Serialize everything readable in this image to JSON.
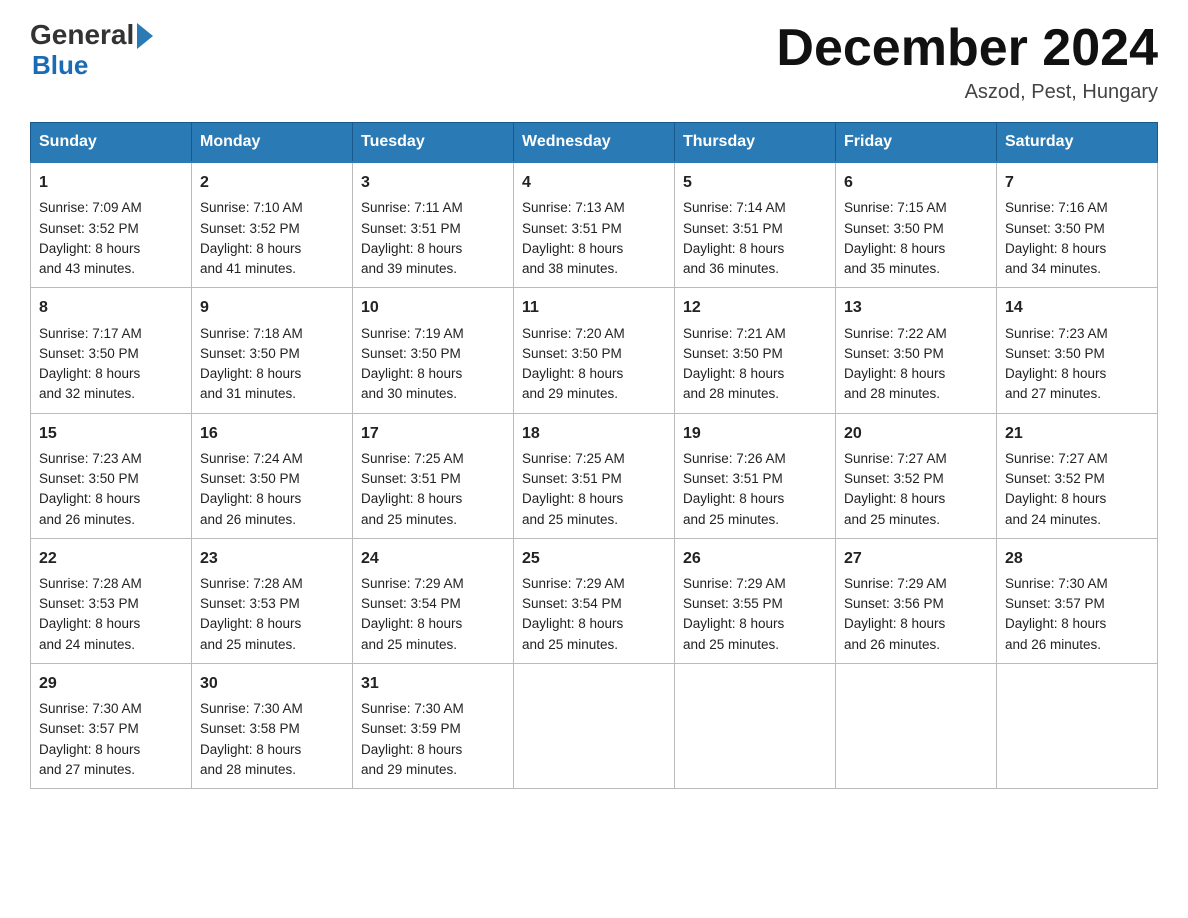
{
  "header": {
    "logo_line1": "General",
    "logo_line2": "Blue",
    "title": "December 2024",
    "location": "Aszod, Pest, Hungary"
  },
  "days_of_week": [
    "Sunday",
    "Monday",
    "Tuesday",
    "Wednesday",
    "Thursday",
    "Friday",
    "Saturday"
  ],
  "weeks": [
    [
      {
        "day": "1",
        "sunrise": "7:09 AM",
        "sunset": "3:52 PM",
        "daylight": "8 hours and 43 minutes."
      },
      {
        "day": "2",
        "sunrise": "7:10 AM",
        "sunset": "3:52 PM",
        "daylight": "8 hours and 41 minutes."
      },
      {
        "day": "3",
        "sunrise": "7:11 AM",
        "sunset": "3:51 PM",
        "daylight": "8 hours and 39 minutes."
      },
      {
        "day": "4",
        "sunrise": "7:13 AM",
        "sunset": "3:51 PM",
        "daylight": "8 hours and 38 minutes."
      },
      {
        "day": "5",
        "sunrise": "7:14 AM",
        "sunset": "3:51 PM",
        "daylight": "8 hours and 36 minutes."
      },
      {
        "day": "6",
        "sunrise": "7:15 AM",
        "sunset": "3:50 PM",
        "daylight": "8 hours and 35 minutes."
      },
      {
        "day": "7",
        "sunrise": "7:16 AM",
        "sunset": "3:50 PM",
        "daylight": "8 hours and 34 minutes."
      }
    ],
    [
      {
        "day": "8",
        "sunrise": "7:17 AM",
        "sunset": "3:50 PM",
        "daylight": "8 hours and 32 minutes."
      },
      {
        "day": "9",
        "sunrise": "7:18 AM",
        "sunset": "3:50 PM",
        "daylight": "8 hours and 31 minutes."
      },
      {
        "day": "10",
        "sunrise": "7:19 AM",
        "sunset": "3:50 PM",
        "daylight": "8 hours and 30 minutes."
      },
      {
        "day": "11",
        "sunrise": "7:20 AM",
        "sunset": "3:50 PM",
        "daylight": "8 hours and 29 minutes."
      },
      {
        "day": "12",
        "sunrise": "7:21 AM",
        "sunset": "3:50 PM",
        "daylight": "8 hours and 28 minutes."
      },
      {
        "day": "13",
        "sunrise": "7:22 AM",
        "sunset": "3:50 PM",
        "daylight": "8 hours and 28 minutes."
      },
      {
        "day": "14",
        "sunrise": "7:23 AM",
        "sunset": "3:50 PM",
        "daylight": "8 hours and 27 minutes."
      }
    ],
    [
      {
        "day": "15",
        "sunrise": "7:23 AM",
        "sunset": "3:50 PM",
        "daylight": "8 hours and 26 minutes."
      },
      {
        "day": "16",
        "sunrise": "7:24 AM",
        "sunset": "3:50 PM",
        "daylight": "8 hours and 26 minutes."
      },
      {
        "day": "17",
        "sunrise": "7:25 AM",
        "sunset": "3:51 PM",
        "daylight": "8 hours and 25 minutes."
      },
      {
        "day": "18",
        "sunrise": "7:25 AM",
        "sunset": "3:51 PM",
        "daylight": "8 hours and 25 minutes."
      },
      {
        "day": "19",
        "sunrise": "7:26 AM",
        "sunset": "3:51 PM",
        "daylight": "8 hours and 25 minutes."
      },
      {
        "day": "20",
        "sunrise": "7:27 AM",
        "sunset": "3:52 PM",
        "daylight": "8 hours and 25 minutes."
      },
      {
        "day": "21",
        "sunrise": "7:27 AM",
        "sunset": "3:52 PM",
        "daylight": "8 hours and 24 minutes."
      }
    ],
    [
      {
        "day": "22",
        "sunrise": "7:28 AM",
        "sunset": "3:53 PM",
        "daylight": "8 hours and 24 minutes."
      },
      {
        "day": "23",
        "sunrise": "7:28 AM",
        "sunset": "3:53 PM",
        "daylight": "8 hours and 25 minutes."
      },
      {
        "day": "24",
        "sunrise": "7:29 AM",
        "sunset": "3:54 PM",
        "daylight": "8 hours and 25 minutes."
      },
      {
        "day": "25",
        "sunrise": "7:29 AM",
        "sunset": "3:54 PM",
        "daylight": "8 hours and 25 minutes."
      },
      {
        "day": "26",
        "sunrise": "7:29 AM",
        "sunset": "3:55 PM",
        "daylight": "8 hours and 25 minutes."
      },
      {
        "day": "27",
        "sunrise": "7:29 AM",
        "sunset": "3:56 PM",
        "daylight": "8 hours and 26 minutes."
      },
      {
        "day": "28",
        "sunrise": "7:30 AM",
        "sunset": "3:57 PM",
        "daylight": "8 hours and 26 minutes."
      }
    ],
    [
      {
        "day": "29",
        "sunrise": "7:30 AM",
        "sunset": "3:57 PM",
        "daylight": "8 hours and 27 minutes."
      },
      {
        "day": "30",
        "sunrise": "7:30 AM",
        "sunset": "3:58 PM",
        "daylight": "8 hours and 28 minutes."
      },
      {
        "day": "31",
        "sunrise": "7:30 AM",
        "sunset": "3:59 PM",
        "daylight": "8 hours and 29 minutes."
      },
      null,
      null,
      null,
      null
    ]
  ],
  "labels": {
    "sunrise": "Sunrise:",
    "sunset": "Sunset:",
    "daylight": "Daylight:"
  }
}
